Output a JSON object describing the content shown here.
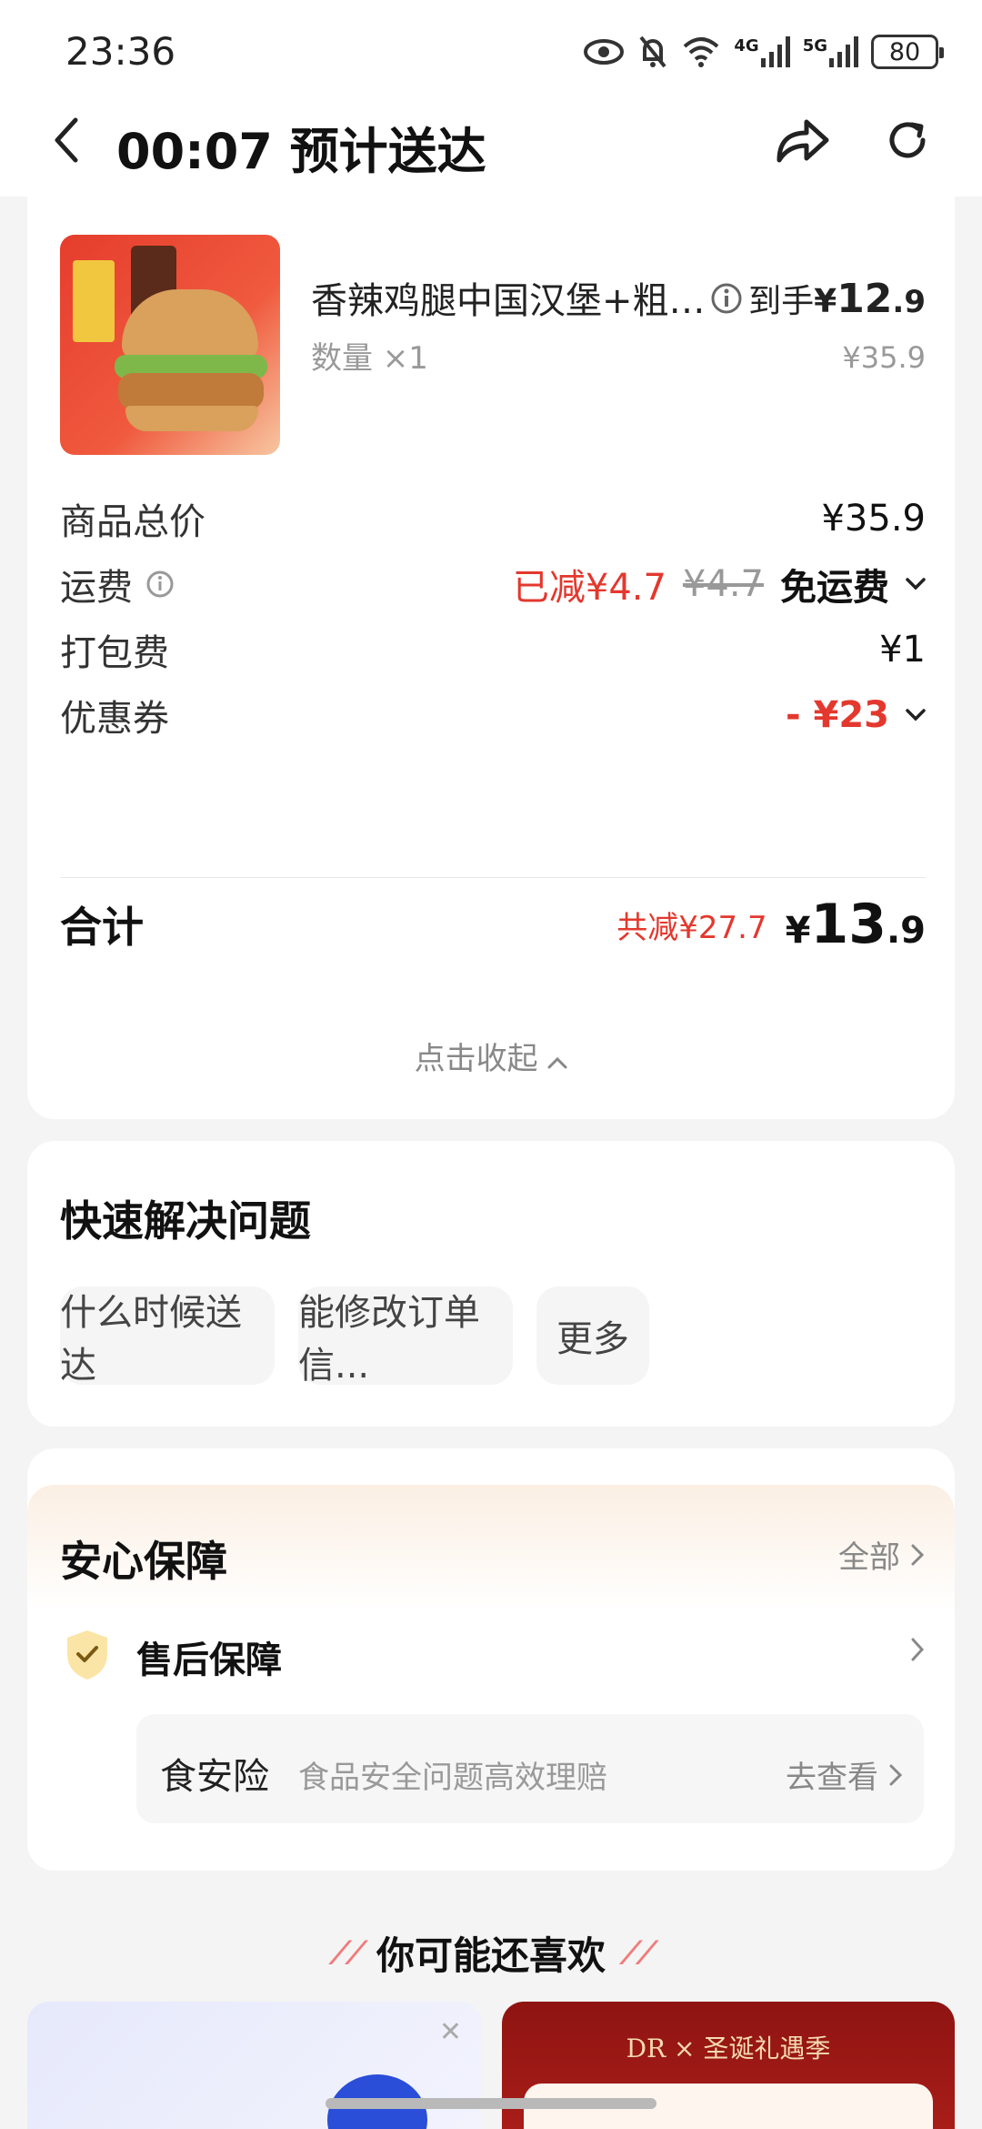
{
  "status_bar": {
    "time": "23:36",
    "net1": "4G",
    "net2": "5G",
    "battery": "80"
  },
  "nav": {
    "title": "00:07 预计送达"
  },
  "product": {
    "name": "香辣鸡腿中国汉堡+粗薯+可乐",
    "qty": "数量 ×1",
    "price_label": "到手",
    "price_yen": "¥",
    "price_int": "12",
    "price_dec": ".9",
    "orig_price": "¥35.9"
  },
  "fees": {
    "subtotal_label": "商品总价",
    "subtotal_value": "¥35.9",
    "shipping_label": "运费",
    "shipping_saved": "已减¥4.7",
    "shipping_orig": "¥4.7",
    "shipping_free": "免运费",
    "packing_label": "打包费",
    "packing_value": "¥1",
    "coupon_label": "优惠券",
    "coupon_value": "- ¥23"
  },
  "total": {
    "label": "合计",
    "saved": "共减¥27.7",
    "yen": "¥",
    "int": "13",
    "dec": ".9",
    "collapse": "点击收起"
  },
  "quick": {
    "title": "快速解决问题",
    "chips": [
      "什么时候送达",
      "能修改订单信...",
      "更多"
    ]
  },
  "guarantee": {
    "title": "安心保障",
    "all": "全部",
    "aftersale": "售后保障",
    "ins_name": "食安险",
    "ins_desc": "食品安全问题高效理赔",
    "ins_go": "去查看"
  },
  "recommend": {
    "title": "你可能还喜欢",
    "ad_text": "DR × 圣诞礼遇季"
  },
  "colors": {
    "accent_red": "#e3382e",
    "card_bg": "#ffffff",
    "page_bg": "#f4f4f4"
  }
}
